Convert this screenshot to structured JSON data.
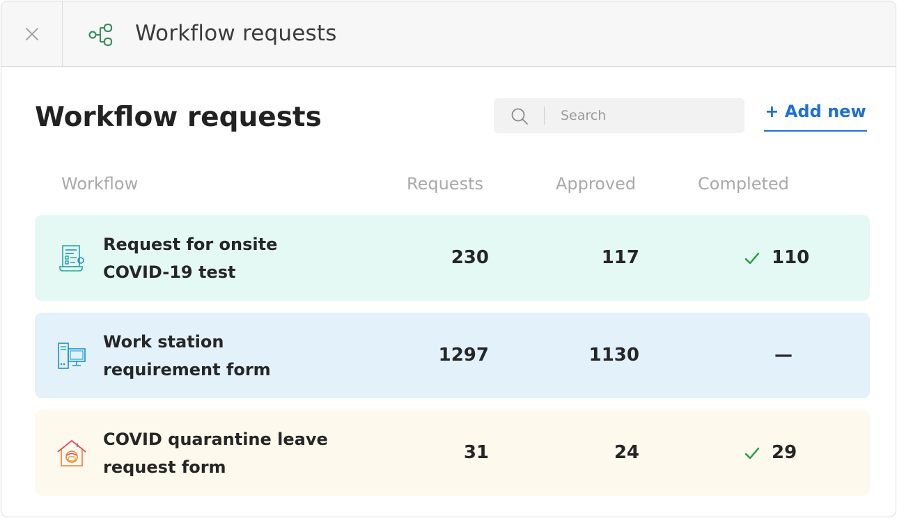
{
  "titlebar": {
    "title": "Workflow requests",
    "close_icon": "close-icon",
    "workflow_icon": "workflow-nodes-icon"
  },
  "page": {
    "title": "Workflow requests"
  },
  "search": {
    "placeholder": "Search",
    "value": ""
  },
  "actions": {
    "add_new_label": "+ Add new"
  },
  "table": {
    "columns": [
      "Workflow",
      "Requests",
      "Approved",
      "Completed"
    ],
    "rows": [
      {
        "name_line1": "Request for onsite",
        "name_line2": "COVID-19 test",
        "requests": "230",
        "approved": "117",
        "completed": "110",
        "completed_check": true,
        "icon": "test-form-icon",
        "bg": "#e4f8f4"
      },
      {
        "name_line1": "Work station",
        "name_line2": "requirement form",
        "requests": "1297",
        "approved": "1130",
        "completed": "—",
        "completed_check": false,
        "icon": "workstation-icon",
        "bg": "#e3f1fb"
      },
      {
        "name_line1": "COVID quarantine leave",
        "name_line2": "request form",
        "requests": "31",
        "approved": "24",
        "completed": "29",
        "completed_check": true,
        "icon": "quarantine-home-icon",
        "bg": "#fdf9ec"
      }
    ]
  },
  "colors": {
    "accent": "#1f6fd6",
    "check": "#1e9e3e",
    "workflow_icon": "#3b8d5c"
  }
}
